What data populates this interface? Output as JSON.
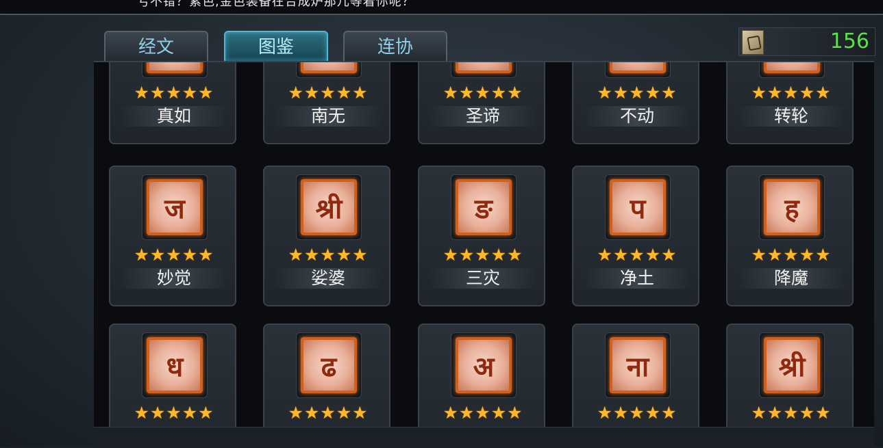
{
  "top_text": "亏不错？紫色,金色装备在合成炉那儿等着你呢？",
  "tabs": [
    {
      "label": "经文",
      "active": false
    },
    {
      "label": "图鉴",
      "active": true
    },
    {
      "label": "连协",
      "active": false
    }
  ],
  "currency": {
    "icon": "scroll-icon",
    "value": "156",
    "color": "#5fe04a"
  },
  "star_char": "★★★★★",
  "rows": [
    {
      "items": [
        {
          "name": "真如",
          "stars": 5
        },
        {
          "name": "南无",
          "stars": 5
        },
        {
          "name": "圣谛",
          "stars": 5
        },
        {
          "name": "不动",
          "stars": 5
        },
        {
          "name": "转轮",
          "stars": 5
        }
      ]
    },
    {
      "items": [
        {
          "name": "妙觉",
          "stars": 5,
          "icon": "rune-icon"
        },
        {
          "name": "娑婆",
          "stars": 5,
          "icon": "rune-icon"
        },
        {
          "name": "三灾",
          "stars": 5,
          "icon": "rune-icon"
        },
        {
          "name": "净土",
          "stars": 5,
          "icon": "rune-icon"
        },
        {
          "name": "降魔",
          "stars": 5,
          "icon": "rune-icon"
        }
      ]
    },
    {
      "items": [
        {
          "stars": 5,
          "icon": "rune-icon"
        },
        {
          "stars": 5,
          "icon": "rune-icon"
        },
        {
          "stars": 5,
          "icon": "rune-icon"
        },
        {
          "stars": 5,
          "icon": "rune-icon"
        },
        {
          "stars": 5,
          "icon": "rune-icon"
        }
      ]
    }
  ],
  "accent_colors": {
    "icon_border": "#d2601a",
    "star": "#ffb829",
    "tab_active": "#2e6f80"
  }
}
